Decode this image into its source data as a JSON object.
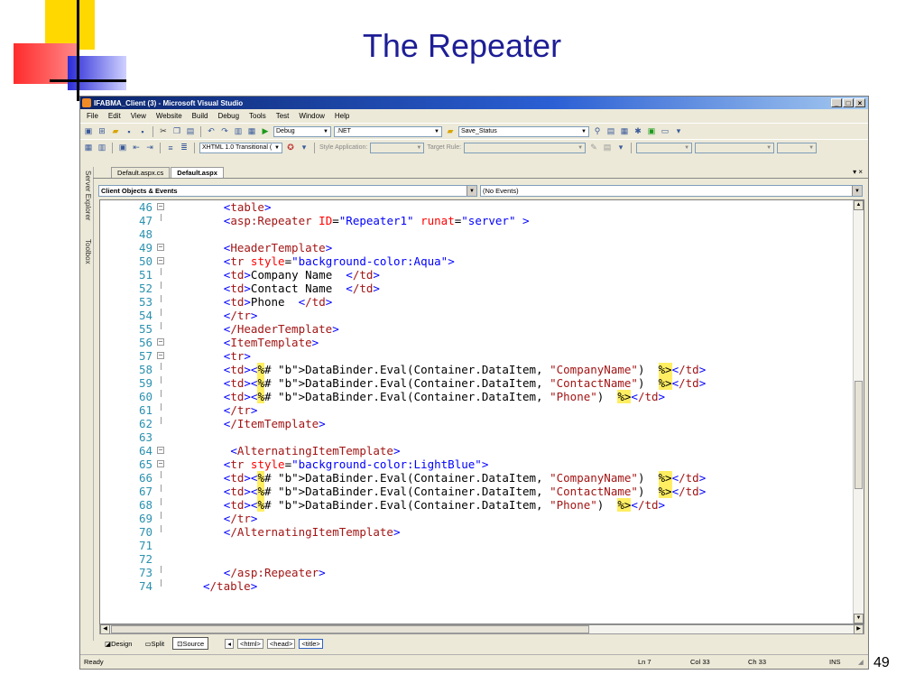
{
  "slide": {
    "title": "The Repeater",
    "page_number": "49"
  },
  "window": {
    "title": "IFABMA_Client (3) - Microsoft Visual Studio",
    "controls": [
      "_",
      "□",
      "×"
    ]
  },
  "menu": [
    "File",
    "Edit",
    "View",
    "Website",
    "Build",
    "Debug",
    "Tools",
    "Test",
    "Window",
    "Help"
  ],
  "toolbar1": {
    "config": "Debug",
    "platform": ".NET",
    "find": "Save_Status"
  },
  "toolbar2": {
    "doctype": "XHTML 1.0 Transitional (",
    "style_app_label": "Style Application:",
    "target_rule_label": "Target Rule:"
  },
  "sidebar": {
    "server_explorer": "Server Explorer",
    "toolbox": "Toolbox"
  },
  "doc_tabs": [
    "Default.aspx.cs",
    "Default.aspx"
  ],
  "tab_controls": "▾ ×",
  "dropdowns": {
    "objects": "Client Objects & Events",
    "events": "(No Events)"
  },
  "code_lines": [
    {
      "n": "46",
      "code": "<table>",
      "indent": 8
    },
    {
      "n": "47",
      "code": "<asp:Repeater ID=\"Repeater1\" runat=\"server\" >",
      "indent": 8
    },
    {
      "n": "48",
      "code": "",
      "indent": 8
    },
    {
      "n": "49",
      "code": "<HeaderTemplate>",
      "indent": 8
    },
    {
      "n": "50",
      "code": "<tr style=\"background-color:Aqua\">",
      "indent": 8
    },
    {
      "n": "51",
      "code": "<td>Company Name  </td>",
      "indent": 8
    },
    {
      "n": "52",
      "code": "<td>Contact Name  </td>",
      "indent": 8
    },
    {
      "n": "53",
      "code": "<td>Phone  </td>",
      "indent": 8
    },
    {
      "n": "54",
      "code": "</tr>",
      "indent": 8
    },
    {
      "n": "55",
      "code": "</HeaderTemplate>",
      "indent": 8
    },
    {
      "n": "56",
      "code": "<ItemTemplate>",
      "indent": 8
    },
    {
      "n": "57",
      "code": "<tr>",
      "indent": 8
    },
    {
      "n": "58",
      "code": "<td><%# DataBinder.Eval(Container.DataItem, \"CompanyName\")  %></td>",
      "indent": 8
    },
    {
      "n": "59",
      "code": "<td><%# DataBinder.Eval(Container.DataItem, \"ContactName\")  %></td>",
      "indent": 8
    },
    {
      "n": "60",
      "code": "<td><%# DataBinder.Eval(Container.DataItem, \"Phone\")  %></td>",
      "indent": 8
    },
    {
      "n": "61",
      "code": "</tr>",
      "indent": 8
    },
    {
      "n": "62",
      "code": "</ItemTemplate>",
      "indent": 8
    },
    {
      "n": "63",
      "code": "",
      "indent": 8
    },
    {
      "n": "64",
      "code": " <AlternatingItemTemplate>",
      "indent": 8
    },
    {
      "n": "65",
      "code": "<tr style=\"background-color:LightBlue\">",
      "indent": 8
    },
    {
      "n": "66",
      "code": "<td><%# DataBinder.Eval(Container.DataItem, \"CompanyName\")  %></td>",
      "indent": 8
    },
    {
      "n": "67",
      "code": "<td><%# DataBinder.Eval(Container.DataItem, \"ContactName\")  %></td>",
      "indent": 8
    },
    {
      "n": "68",
      "code": "<td><%# DataBinder.Eval(Container.DataItem, \"Phone\")  %></td>",
      "indent": 8
    },
    {
      "n": "69",
      "code": "</tr>",
      "indent": 8
    },
    {
      "n": "70",
      "code": "</AlternatingItemTemplate>",
      "indent": 8
    },
    {
      "n": "71",
      "code": "",
      "indent": 8
    },
    {
      "n": "72",
      "code": "",
      "indent": 8
    },
    {
      "n": "73",
      "code": "</asp:Repeater>",
      "indent": 8
    },
    {
      "n": "74",
      "code": "</table>",
      "indent": 5
    }
  ],
  "views": [
    "Design",
    "Split",
    "Source"
  ],
  "breadcrumbs": [
    "<html>",
    "<head>",
    "<title>"
  ],
  "status": {
    "text": "Ready",
    "ln": "Ln 7",
    "col": "Col 33",
    "ch": "Ch 33",
    "mode": "INS"
  }
}
